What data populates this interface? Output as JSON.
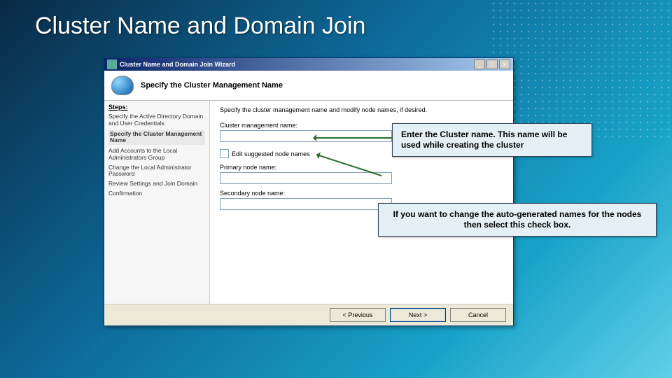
{
  "slide": {
    "title": "Cluster Name and Domain Join"
  },
  "wizard": {
    "window_title": "Cluster Name and Domain Join Wizard",
    "header_title": "Specify the Cluster Management Name",
    "instruction": "Specify the cluster management name and modify node names, if desired.",
    "steps_header": "Steps:",
    "steps": [
      "Specify the Active Directory Domain and User Credentials",
      "Specify the Cluster Management Name",
      "Add Accounts to the Local Administrators Group",
      "Change the Local Administrator Password",
      "Review Settings and Join Domain",
      "Confirmation"
    ],
    "current_step_index": 1,
    "fields": {
      "cluster_mgmt_label": "Cluster management name:",
      "cluster_mgmt_value": "",
      "edit_nodes_label": "Edit suggested node names",
      "primary_label": "Primary node name:",
      "primary_value": "",
      "secondary_label": "Secondary node name:",
      "secondary_value": ""
    },
    "buttons": {
      "previous": "< Previous",
      "next": "Next >",
      "cancel": "Cancel"
    }
  },
  "callouts": {
    "c1": "Enter the Cluster name. This name will be used while creating the cluster",
    "c2": "If you want to change the auto-generated names for the nodes then select this check box."
  }
}
